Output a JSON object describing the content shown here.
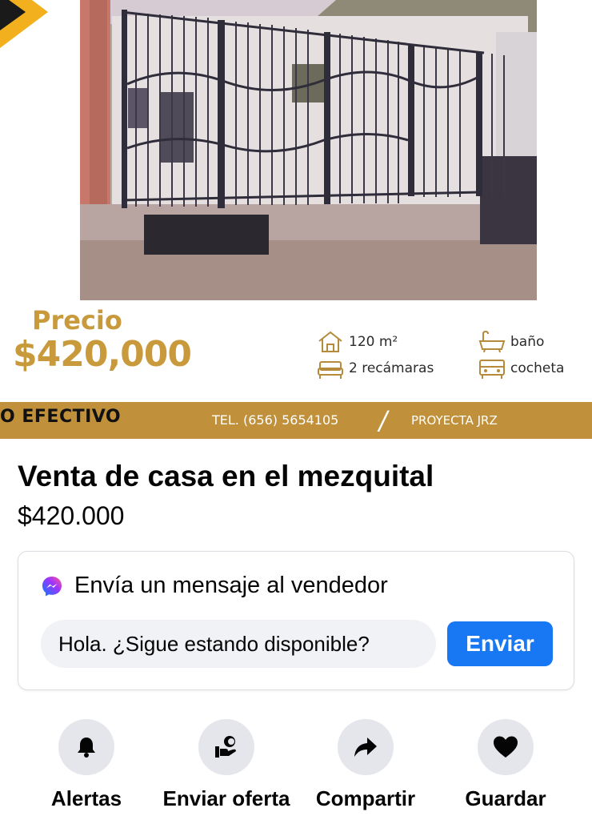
{
  "banner": {
    "price_label": "Precio",
    "price_value": "$420,000",
    "features": {
      "area": "120 m²",
      "bedrooms": "2 recámaras",
      "bathroom": "baño",
      "garage": "cocheta"
    },
    "band": {
      "payment": "O EFECTIVO",
      "phone": "TEL. (656) 5654105",
      "separator": "/",
      "brand": "PROYECTA JRZ"
    }
  },
  "listing": {
    "title": "Venta de casa en el mezquital",
    "price": "$420.000"
  },
  "message": {
    "header": "Envía un mensaje al vendedor",
    "input_value": "Hola. ¿Sigue estando disponible?",
    "send_label": "Enviar"
  },
  "actions": [
    {
      "label": "Alertas",
      "icon": "bell-icon"
    },
    {
      "label": "Enviar oferta",
      "icon": "offer-icon"
    },
    {
      "label": "Compartir",
      "icon": "share-icon"
    },
    {
      "label": "Guardar",
      "icon": "heart-icon"
    }
  ],
  "colors": {
    "gold": "#c0903a",
    "price_gold": "#c99a3c",
    "facebook_blue": "#1877f2",
    "circle_gray": "#e4e6eb"
  }
}
